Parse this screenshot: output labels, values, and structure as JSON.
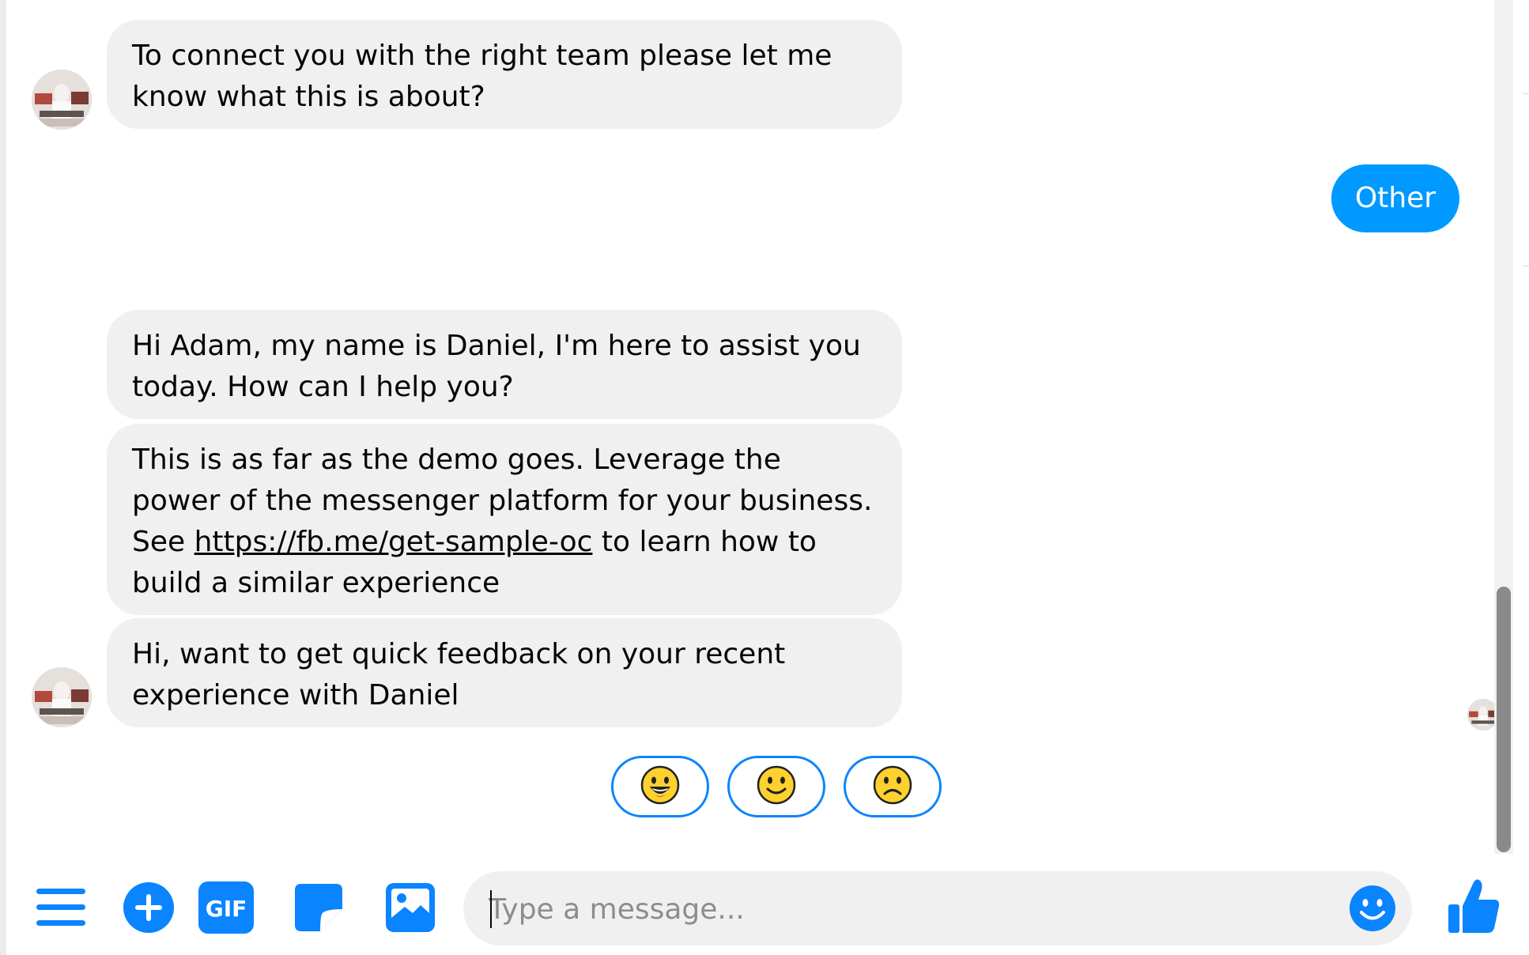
{
  "messages": [
    {
      "sender": "page",
      "text": "To connect you with the right team please let me know what this is about?"
    },
    {
      "sender": "user",
      "text": "Other"
    },
    {
      "sender": "page",
      "text": "Hi Adam, my name is Daniel, I'm here to assist you today. How can I help you?"
    },
    {
      "sender": "page",
      "text_before": "This is as far as the demo goes. Leverage the power of the messenger platform for your business. See ",
      "link": "https://fb.me/get-sample-oc",
      "text_after": " to learn how to build a similar experience"
    },
    {
      "sender": "page",
      "text": "Hi, want to get quick feedback on your recent experience with Daniel"
    }
  ],
  "quick_replies": [
    {
      "icon": "grinning-face-icon"
    },
    {
      "icon": "slightly-smiling-face-icon"
    },
    {
      "icon": "slightly-frowning-face-icon"
    }
  ],
  "composer": {
    "placeholder": "Type a message...",
    "toolbar_icons": [
      "menu-icon",
      "add-icon",
      "gif-icon",
      "sticker-icon",
      "image-icon"
    ],
    "gif_label": "GIF",
    "emoji_icon": "emoji-icon",
    "send_icon": "thumbs-up-icon"
  },
  "colors": {
    "accent": "#0099ff",
    "bubble_gray": "#f0f0f0",
    "quick_reply_border": "#0a84ff"
  }
}
